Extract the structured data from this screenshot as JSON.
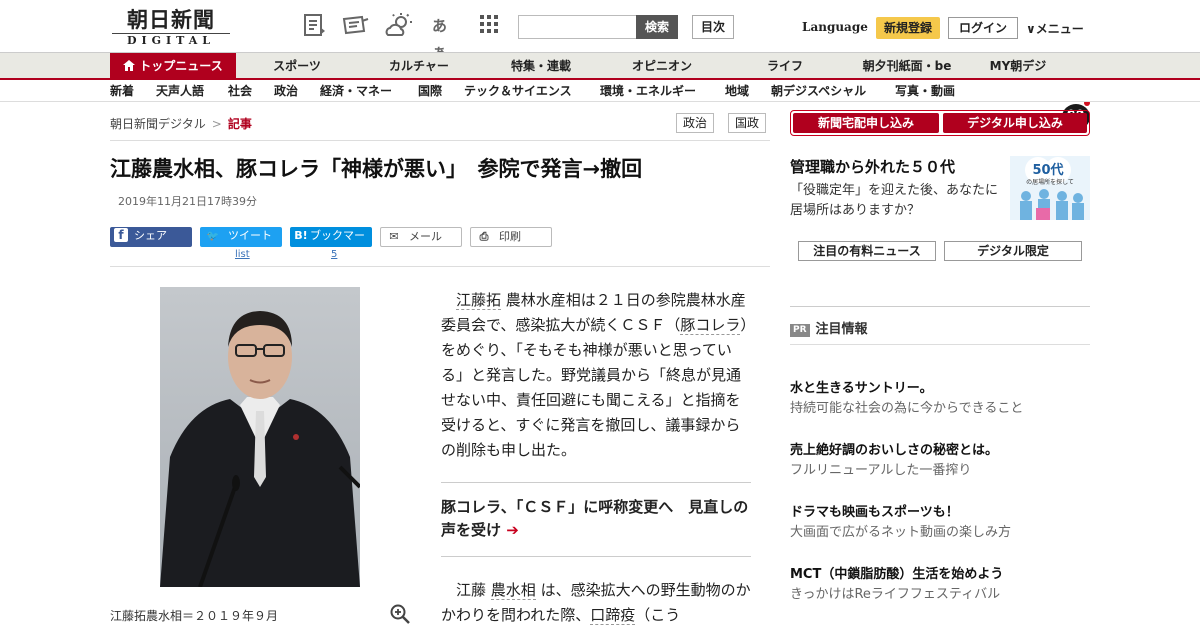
{
  "header": {
    "logo_main": "朝日新聞",
    "logo_sub": "DIGITAL",
    "search_placeholder": "",
    "search_button": "検索",
    "toc_button": "目次",
    "language": "Language",
    "register": "新規登録",
    "login": "ログイン",
    "menu": "∨メニュー",
    "icons": [
      "digest-icon",
      "newspaper-icon",
      "weather-icon",
      "font-size-icon",
      "grid-icon"
    ],
    "font_icon_text": "あぁ"
  },
  "nav_main": [
    "トップニュース",
    "スポーツ",
    "カルチャー",
    "特集・連載",
    "オピニオン",
    "ライフ",
    "朝夕刊紙面・be",
    "MY朝デジ"
  ],
  "nav_sub": [
    "新着",
    "天声人語",
    "社会",
    "政治",
    "経済・マネー",
    "国際",
    "テック＆サイエンス",
    "環境・エネルギー",
    "地域",
    "朝デジスペシャル",
    "写真・動画"
  ],
  "breadcrumb": {
    "home": "朝日新聞デジタル",
    "sep": ">",
    "current": "記事"
  },
  "tags": [
    "政治",
    "国政"
  ],
  "article": {
    "title": "江藤農水相、豚コレラ「神様が悪い」　参院で発言→撤回",
    "date": "2019年11月21日17時39分",
    "caption": "江藤拓農水相＝２０１９年９月",
    "p1_name": "江藤拓",
    "p1_a": " 農林水産相は２１日の参院農林水産委員会で、感染拡大が続くＣＳＦ（",
    "p1_link": "豚コレラ",
    "p1_b": "）をめぐり、「そもそも神様が悪いと思っている」と発言した。野党議員から「終息が見通せない中、責任回避にも聞こえる」と指摘を受けると、すぐに発言を撤回し、議事録からの削除も申し出た。",
    "related": "豚コレラ、「ＣＳＦ」に呼称変更へ　見直しの声を受け",
    "related_arrow": "➔",
    "p2_a": "江藤 ",
    "p2_name": "農水相",
    "p2_b": " は、感染拡大への野生動物のかかわりを問われた際、",
    "p2_link": "口蹄疫",
    "p2_c": "（こう"
  },
  "share": {
    "facebook": {
      "icon": "f",
      "label": "シェア"
    },
    "twitter": {
      "icon": "🐦",
      "label": "ツイート",
      "count": "list"
    },
    "hatena": {
      "icon": "B!",
      "label": "ブックマーク",
      "count": "5"
    },
    "mail": {
      "icon": "✉",
      "label": "メール"
    },
    "print": {
      "icon": "⎙",
      "label": "印刷"
    }
  },
  "sidebar": {
    "subscribe_paper": "新聞宅配申し込み",
    "subscribe_digital": "デジタル申し込み",
    "promo_title": "管理職から外れた５０代",
    "promo_text": "「役職定年」を迎えた後、あなたに居場所はありますか？",
    "promo_image_title": "50代",
    "promo_image_sub": "の居場所を探して",
    "tab_paid": "注目の有料ニュース",
    "tab_digital": "デジタル限定",
    "pr_badge": "PR",
    "pr_heading": "注目情報",
    "pr_items": [
      {
        "title": "水と生きるサントリー。",
        "sub": "持続可能な社会の為に今からできること"
      },
      {
        "title": "売上絶好調のおいしさの秘密とは。",
        "sub": "フルリニューアルした一番搾り"
      },
      {
        "title": "ドラマも映画もスポーツも！",
        "sub": "大画面で広がるネット動画の楽しみ方"
      },
      {
        "title": "MCT（中鎖脂肪酸）生活を始めよう",
        "sub": "きっかけはReライフフェスティバル"
      }
    ]
  },
  "colors": {
    "brand_red": "#b0001e",
    "register_yellow": "#f5c84b",
    "facebook": "#3b5998",
    "twitter": "#1da1f2",
    "hatena": "#008fde"
  }
}
